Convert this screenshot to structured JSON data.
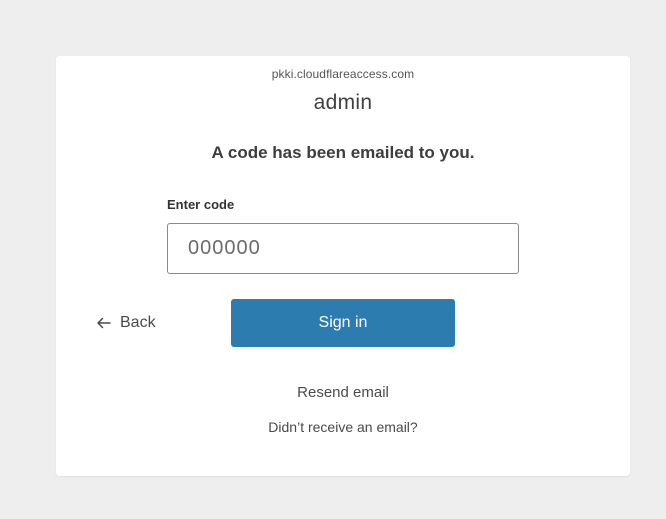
{
  "header": {
    "domain": "pkki.cloudflareaccess.com",
    "username": "admin"
  },
  "main": {
    "heading": "A code has been emailed to you.",
    "code_label": "Enter code",
    "code_value": "",
    "code_placeholder": "000000"
  },
  "actions": {
    "back_label": "Back",
    "back_icon": "arrow-left-icon",
    "signin_label": "Sign in",
    "resend_label": "Resend email",
    "help_label": "Didn’t receive an email?"
  },
  "colors": {
    "background": "#eeeeee",
    "card": "#ffffff",
    "primary_button": "#2c7cb0",
    "text": "#4a4a4a"
  }
}
